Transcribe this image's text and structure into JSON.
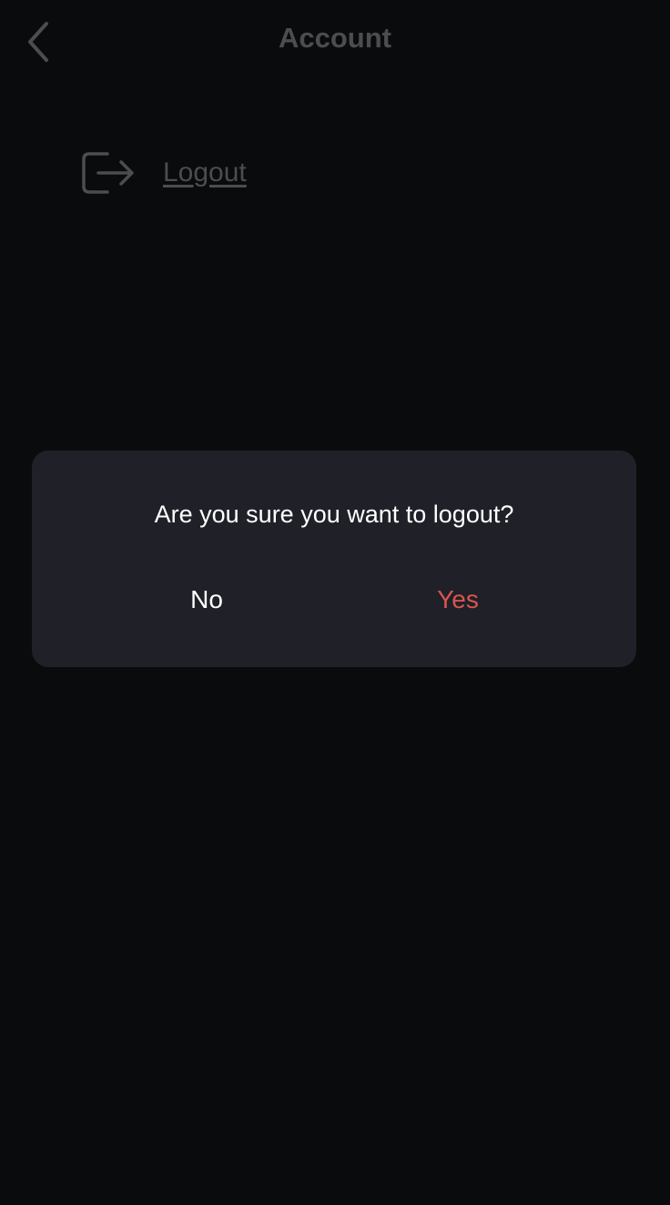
{
  "header": {
    "title": "Account",
    "back_icon": "chevron-left-icon"
  },
  "menu": {
    "logout_label": "Logout",
    "logout_icon": "logout-icon"
  },
  "dialog": {
    "message": "Are you sure you want to logout?",
    "no_label": "No",
    "yes_label": "Yes"
  },
  "colors": {
    "background": "#0a0b0d",
    "muted_text": "#4c4d50",
    "dialog_background": "#1f2028",
    "primary_text": "#ffffff",
    "destructive": "#d95550"
  }
}
